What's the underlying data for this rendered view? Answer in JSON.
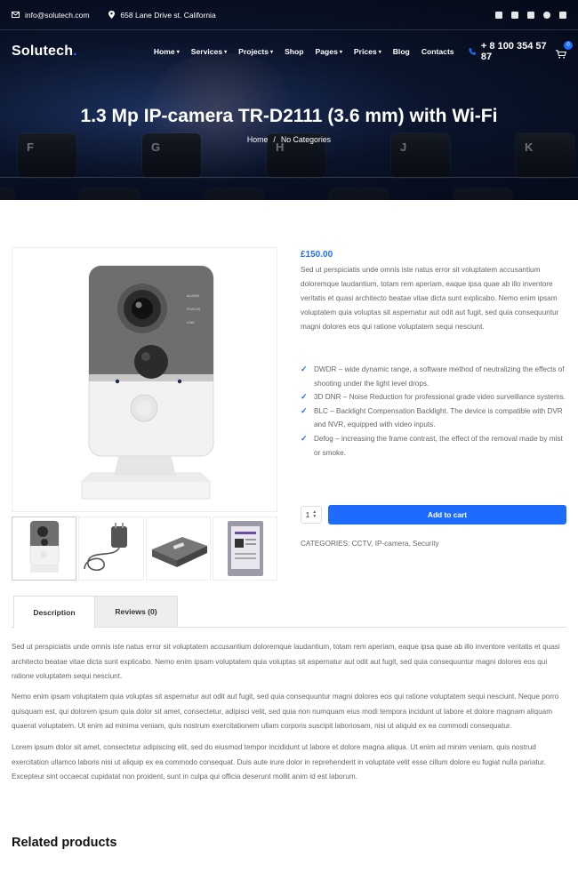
{
  "topbar": {
    "email": "info@solutech.com",
    "address": "658 Lane Drive st. California",
    "socials": [
      "facebook-icon",
      "twitter-icon",
      "youtube-icon",
      "github-icon",
      "linkedin-icon"
    ]
  },
  "nav": {
    "logo": "Solutech",
    "logo_dot": ".",
    "items": [
      {
        "label": "Home",
        "dropdown": true
      },
      {
        "label": "Services",
        "dropdown": true
      },
      {
        "label": "Projects",
        "dropdown": true
      },
      {
        "label": "Shop",
        "dropdown": false
      },
      {
        "label": "Pages",
        "dropdown": true
      },
      {
        "label": "Prices",
        "dropdown": true
      },
      {
        "label": "Blog",
        "dropdown": false
      },
      {
        "label": "Contacts",
        "dropdown": false
      }
    ],
    "phone": "+ 8 100 354 57 87",
    "cart_count": "0"
  },
  "hero": {
    "title": "1.3 Mp IP-camera TR-D2111 (3.6 mm) with Wi-Fi",
    "breadcrumb_home": "Home",
    "breadcrumb_sep": "/",
    "breadcrumb_current": "No Categories",
    "keys": [
      "F",
      "G",
      "H",
      "J",
      "K"
    ]
  },
  "product": {
    "price": "£150.00",
    "short_description": "Sed ut perspiciatis unde omnis iste natus error sit voluptatem accusantium doloremque laudantium, totam rem aperiam, eaque ipsa quae ab illo inventore veritatis et quasi architecto beatae vitae dicta sunt explicabo. Nemo enim ipsam voluptatem quia voluptas sit aspernatur aut odit aut fugit, sed quia consequuntur magni dolores eos qui ratione voluptatem sequi nesciunt.",
    "features": [
      "DWDR – wide dynamic range, a software method of neutralizing the effects of shooting under the light level drops.",
      "3D DNR – Noise Reduction for professional grade video surveillance systems.",
      "BLC – Backlight Compensation Backlight. The device is compatible with DVR and NVR, equipped with video inputs.",
      "Defog – increasing the frame contrast, the effect of the removal made by mist or smoke."
    ],
    "quantity": "1",
    "add_to_cart": "Add to cart",
    "categories": "CATEGORIES: CCTV, IP-camera, Security",
    "camera_labels": [
      "ALARM",
      "STATUS",
      "LINK"
    ]
  },
  "tabs": {
    "description": "Description",
    "reviews": "Reviews (0)"
  },
  "description": {
    "p1": "Sed ut perspiciatis unde omnis iste natus error sit voluptatem accusantium doloremque laudantium, totam rem aperiam, eaque ipsa quae ab illo inventore veritatis et quasi architecto beatae vitae dicta sunt explicabo. Nemo enim ipsam voluptatem quia voluptas sit aspernatur aut odit aut fugit, sed quia consequuntur magni dolores eos qui ratione voluptatem sequi nesciunt.",
    "p2": "Nemo enim ipsam voluptatem quia voluptas sit aspernatur aut odit aut fugit, sed quia consequuntur magni dolores eos qui ratione voluptatem sequi nesciunt. Neque porro quisquam est, qui dolorem ipsum quia dolor sit amet, consectetur, adipisci velit, sed quia non numquam eius modi tempora incidunt ut labore et dolore magnam aliquam quaerat voluptatem. Ut enim ad minima veniam, quis nostrum exercitationem ullam corporis suscipit laboriosam, nisi ut aliquid ex ea commodi consequatur.",
    "p3": "Lorem ipsum dolor sit amet, consectetur adipiscing elit, sed do eiusmod tempor incididunt ut labore et dolore magna aliqua. Ut enim ad minim veniam, quis nostrud exercitation ullamco laboris nisi ut aliquip ex ea commodo consequat. Duis aute irure dolor in reprehenderit in voluptate velit esse cillum dolore eu fugiat nulla pariatur. Excepteur sint occaecat cupidatat non proident, sunt in culpa qui officia deserunt mollit anim id est laborum."
  },
  "related": {
    "title": "Related products"
  },
  "colors": {
    "accent": "#1e6bff",
    "hero_dark": "#0b1630",
    "text": "#666666"
  }
}
